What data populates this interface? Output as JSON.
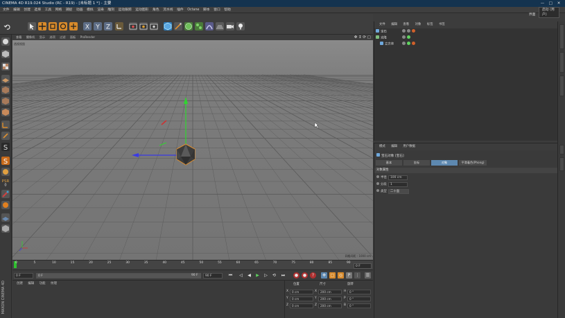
{
  "window": {
    "title": "CINEMA 4D R19.024 Studio (RC - R19) - [未标题 1 *] - 主要",
    "controls": [
      "—",
      "□",
      "✕"
    ]
  },
  "menubar": {
    "items": [
      "文件",
      "编辑",
      "创建",
      "选择",
      "工具",
      "网格",
      "捕捉",
      "动画",
      "模拟",
      "渲染",
      "雕刻",
      "运动跟踪",
      "运动图形",
      "角色",
      "流水线",
      "插件",
      "Octane",
      "脚本",
      "窗口",
      "帮助"
    ],
    "layout_label": "界面",
    "layout_value": "启动 (用户)"
  },
  "viewport": {
    "menu": [
      "查看",
      "摄像机",
      "显示",
      "选项",
      "过滤",
      "面板",
      "ProRender"
    ],
    "camera_label": "透视视图",
    "grid_label": "网格间距 : 1000 cm"
  },
  "timeline": {
    "ticks": [
      "0",
      "5",
      "10",
      "15",
      "20",
      "25",
      "30",
      "35",
      "40",
      "45",
      "50",
      "55",
      "60",
      "65",
      "70",
      "75",
      "80",
      "85",
      "90"
    ],
    "current_frame": "0 F"
  },
  "playbar": {
    "start": "0 F",
    "range_start": "0 F",
    "range_end": "90 F",
    "end": "90 F"
  },
  "material": {
    "menu": [
      "创建",
      "编辑",
      "功能",
      "纹理"
    ]
  },
  "coordinates": {
    "headers": [
      "位置",
      "尺寸",
      "旋转"
    ],
    "rows": [
      {
        "axis": "X",
        "pos": "0 cm",
        "size_axis": "X",
        "size": "200 cm",
        "rot_axis": "H",
        "rot": "0 °"
      },
      {
        "axis": "Y",
        "pos": "0 cm",
        "size_axis": "Y",
        "size": "200 cm",
        "rot_axis": "P",
        "rot": "0 °"
      },
      {
        "axis": "Z",
        "pos": "0 cm",
        "size_axis": "Z",
        "size": "200 cm",
        "rot_axis": "B",
        "rot": "0 °"
      }
    ]
  },
  "object_manager": {
    "menu": [
      "文件",
      "编辑",
      "查看",
      "对象",
      "标签",
      "书签"
    ],
    "objects": [
      {
        "name": "宝石",
        "color": "#6fa8dc",
        "selected": false
      },
      {
        "name": "克隆",
        "color": "#7fbf7f",
        "selected": false
      },
      {
        "name": "立方体",
        "color": "#6fa8dc",
        "selected": false
      }
    ]
  },
  "attributes": {
    "menu": [
      "模式",
      "编辑",
      "用户数据"
    ],
    "title": "宝石对象 [宝石]",
    "tabs": [
      "基本",
      "坐标",
      "对象",
      "平滑着色(Phong)"
    ],
    "active_tab": 2,
    "section": "对象属性",
    "props": [
      {
        "label": "半径",
        "value": "100 cm"
      },
      {
        "label": "分段",
        "value": "1"
      },
      {
        "label": "类型",
        "value": "二十面"
      }
    ]
  },
  "brand": {
    "vertical_label": "MAXON CINEMA 4D"
  }
}
